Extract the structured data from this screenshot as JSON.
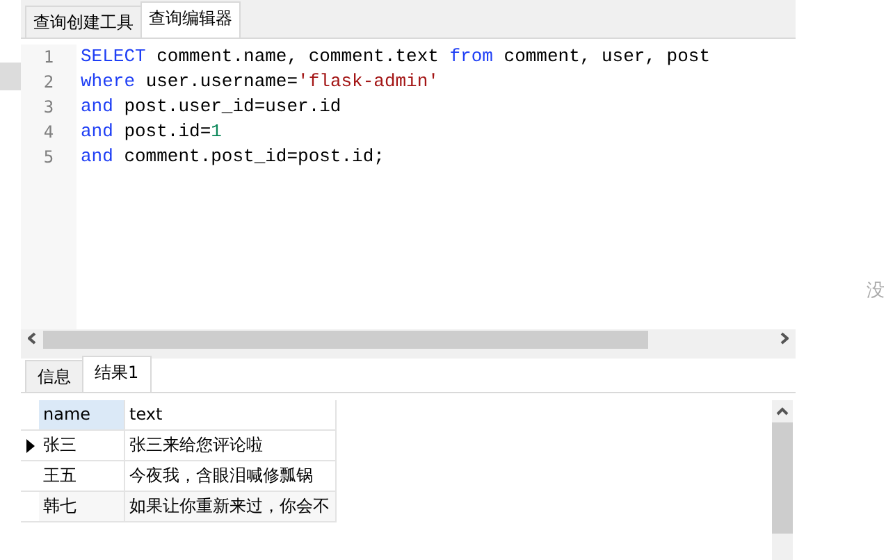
{
  "editor_tabs": [
    {
      "label": "查询创建工具",
      "selected": false
    },
    {
      "label": "查询编辑器",
      "selected": true
    }
  ],
  "code_lines": [
    {
      "number": "1",
      "tokens": [
        {
          "kind": "keyword",
          "text": "SELECT"
        },
        {
          "kind": "plain",
          "text": " comment.name, comment.text "
        },
        {
          "kind": "keyword",
          "text": "from"
        },
        {
          "kind": "plain",
          "text": " comment, user, post"
        }
      ]
    },
    {
      "number": "2",
      "tokens": [
        {
          "kind": "keyword",
          "text": "where"
        },
        {
          "kind": "plain",
          "text": " user.username="
        },
        {
          "kind": "string",
          "text": "'flask-admin'"
        }
      ]
    },
    {
      "number": "3",
      "tokens": [
        {
          "kind": "keyword",
          "text": "and"
        },
        {
          "kind": "plain",
          "text": " post.user_id=user.id"
        }
      ]
    },
    {
      "number": "4",
      "tokens": [
        {
          "kind": "keyword",
          "text": "and"
        },
        {
          "kind": "plain",
          "text": " post.id="
        },
        {
          "kind": "number",
          "text": "1"
        }
      ]
    },
    {
      "number": "5",
      "tokens": [
        {
          "kind": "keyword",
          "text": "and"
        },
        {
          "kind": "plain",
          "text": " comment.post_id=post.id;"
        }
      ]
    }
  ],
  "result_tabs": [
    {
      "label": "信息",
      "selected": false
    },
    {
      "label": "结果1",
      "selected": true
    }
  ],
  "table": {
    "columns": [
      {
        "label": "name",
        "selected": true
      },
      {
        "label": "text",
        "selected": false
      }
    ],
    "rows": [
      {
        "cells": [
          "张三",
          "张三来给您评论啦"
        ],
        "selected": true
      },
      {
        "cells": [
          "王五",
          "今夜我，含眼泪喊修瓢锅"
        ],
        "selected": false
      },
      {
        "cells": [
          "韩七",
          "如果让你重新来过，你会不"
        ],
        "selected": false
      }
    ]
  },
  "side_text": "没"
}
